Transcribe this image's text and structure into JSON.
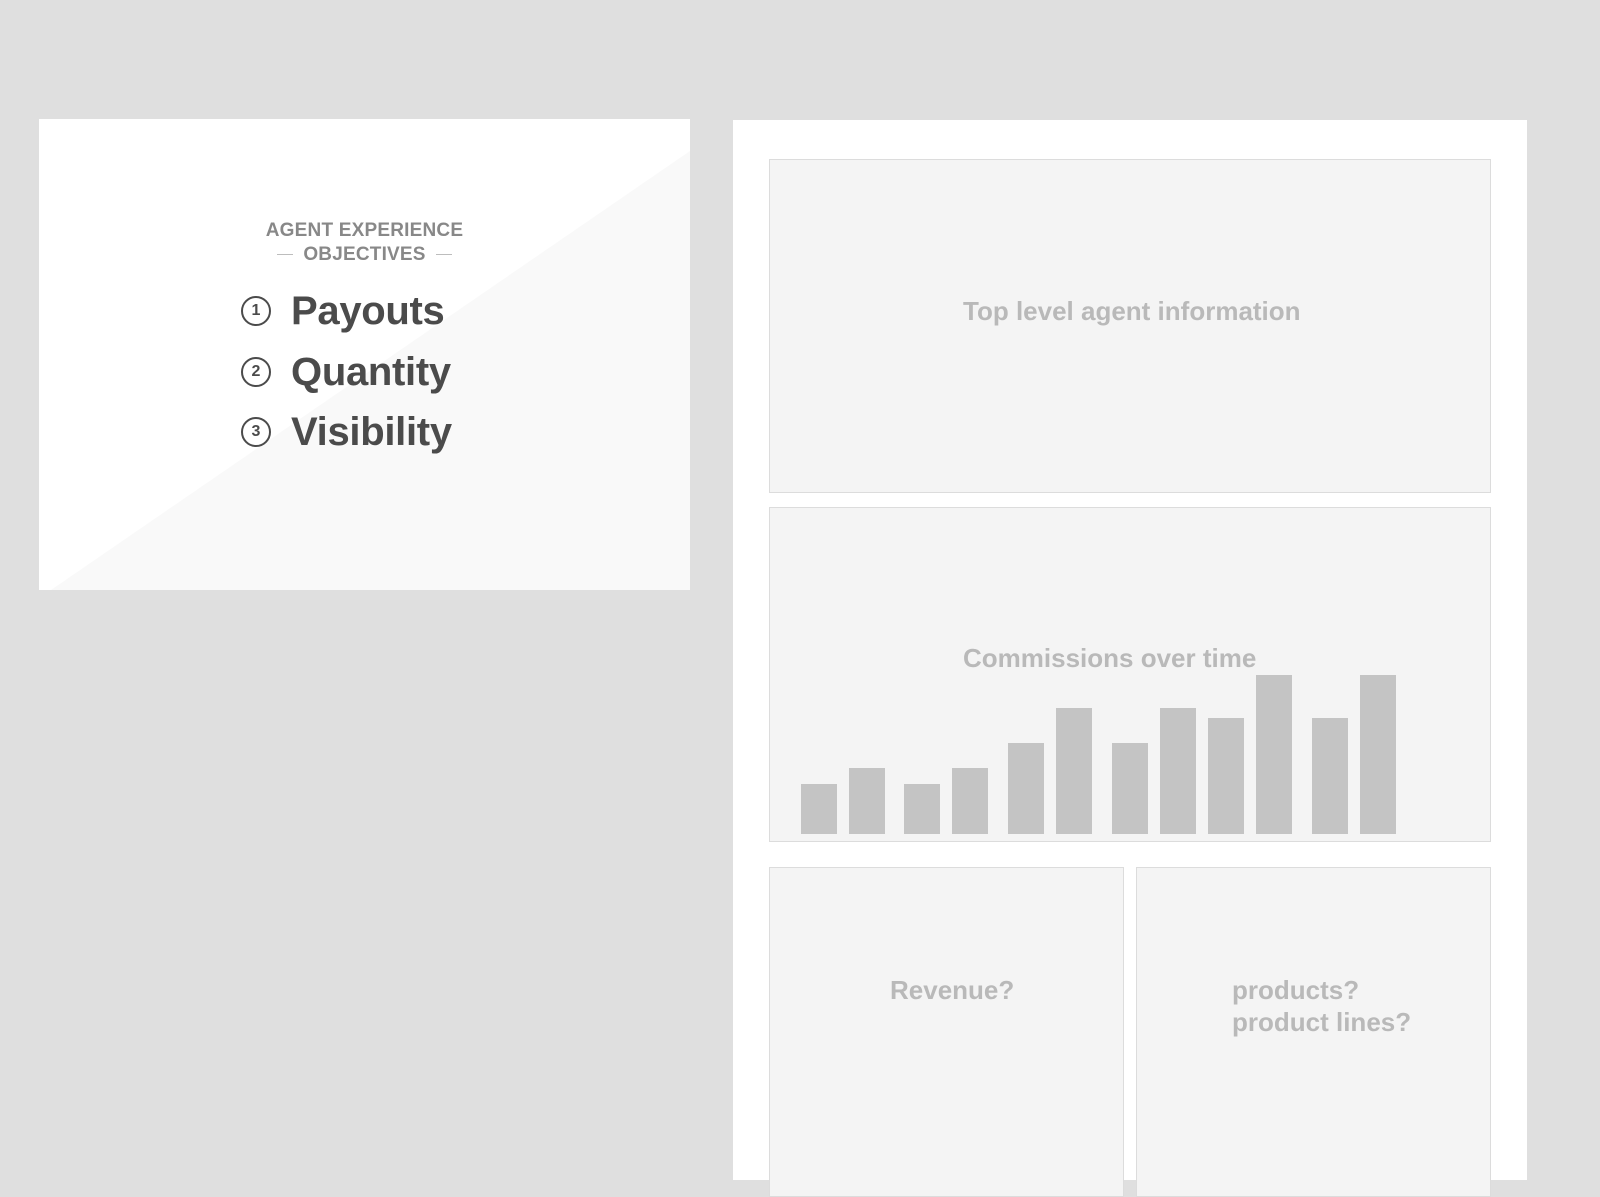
{
  "objectives": {
    "title_line1": "AGENT EXPERIENCE",
    "title_line2": "OBJECTIVES",
    "items": [
      {
        "number": "1",
        "label": "Payouts"
      },
      {
        "number": "2",
        "label": "Quantity"
      },
      {
        "number": "3",
        "label": "Visibility"
      }
    ]
  },
  "wireframe": {
    "top_box_label": "Top level agent information",
    "chart_box_label": "Commissions over time",
    "revenue_box_label": "Revenue?",
    "products_box_line1": "products?",
    "products_box_line2": "product lines?"
  },
  "chart_data": {
    "type": "bar",
    "title": "Commissions over time",
    "xlabel": "",
    "ylabel": "",
    "values": [
      3,
      4,
      3,
      4,
      5.5,
      7.6,
      5.5,
      7.6,
      7,
      9.6,
      7,
      9.6
    ],
    "ylim": [
      0,
      9.6
    ],
    "grid": false,
    "colors": {
      "bar": "#c4c4c4"
    }
  }
}
